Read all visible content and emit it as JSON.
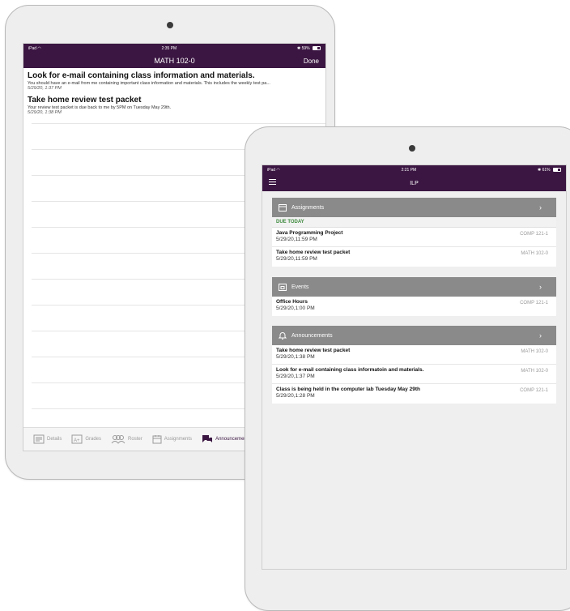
{
  "back_device": {
    "status": {
      "carrier": "iPad",
      "time": "2:35 PM",
      "battery": "59%",
      "battery_level": 0.59
    },
    "nav": {
      "title": "MATH 102-0",
      "done_label": "Done"
    },
    "announcements": [
      {
        "title": "Look for e-mail containing class information and materials.",
        "body": "You should have an e-mail from me containing important class information and materials. This includes the weekly test pa...",
        "date": "5/29/20, 1:37 PM"
      },
      {
        "title": "Take home review test packet",
        "body": "Your review test packet is due back to me by 5PM on Tuesday May 29th.",
        "date": "5/29/20, 1:38 PM"
      }
    ],
    "tabs": [
      {
        "label": "Details",
        "icon": "details-icon"
      },
      {
        "label": "Grades",
        "icon": "grades-icon"
      },
      {
        "label": "Roster",
        "icon": "roster-icon"
      },
      {
        "label": "Assignments",
        "icon": "assignments-icon"
      },
      {
        "label": "Announcements",
        "icon": "announcements-icon",
        "active": true
      }
    ]
  },
  "front_device": {
    "status": {
      "carrier": "iPad",
      "time": "2:21 PM",
      "battery": "61%",
      "battery_level": 0.61
    },
    "nav": {
      "title": "ILP"
    },
    "assignments": {
      "header": "Assignments",
      "due_label": "DUE TODAY",
      "items": [
        {
          "title": "Java Programming Project",
          "date": "5/29/20,11:59 PM",
          "course": "COMP 121-1"
        },
        {
          "title": "Take home review test packet",
          "date": "5/29/20,11:59 PM",
          "course": "MATH 102-0"
        }
      ]
    },
    "events": {
      "header": "Events",
      "items": [
        {
          "title": "Office Hours",
          "date": "5/29/20,1:00 PM",
          "course": "COMP 121-1"
        }
      ]
    },
    "announcements": {
      "header": "Announcements",
      "items": [
        {
          "title": "Take home review test packet",
          "date": "5/29/20,1:38 PM",
          "course": "MATH 102-0"
        },
        {
          "title": "Look for e-mail containing class informatoin and materials.",
          "date": "5/29/20,1:37 PM",
          "course": "MATH 102-0"
        },
        {
          "title": "Class is being held in the computer lab Tuesday May 29th",
          "date": "5/29/20,1:28 PM",
          "course": "COMP 121-1"
        }
      ]
    }
  },
  "colors": {
    "brand": "#3b1642",
    "section_header": "#8a8a8a",
    "due_today": "#3e8a3e"
  }
}
